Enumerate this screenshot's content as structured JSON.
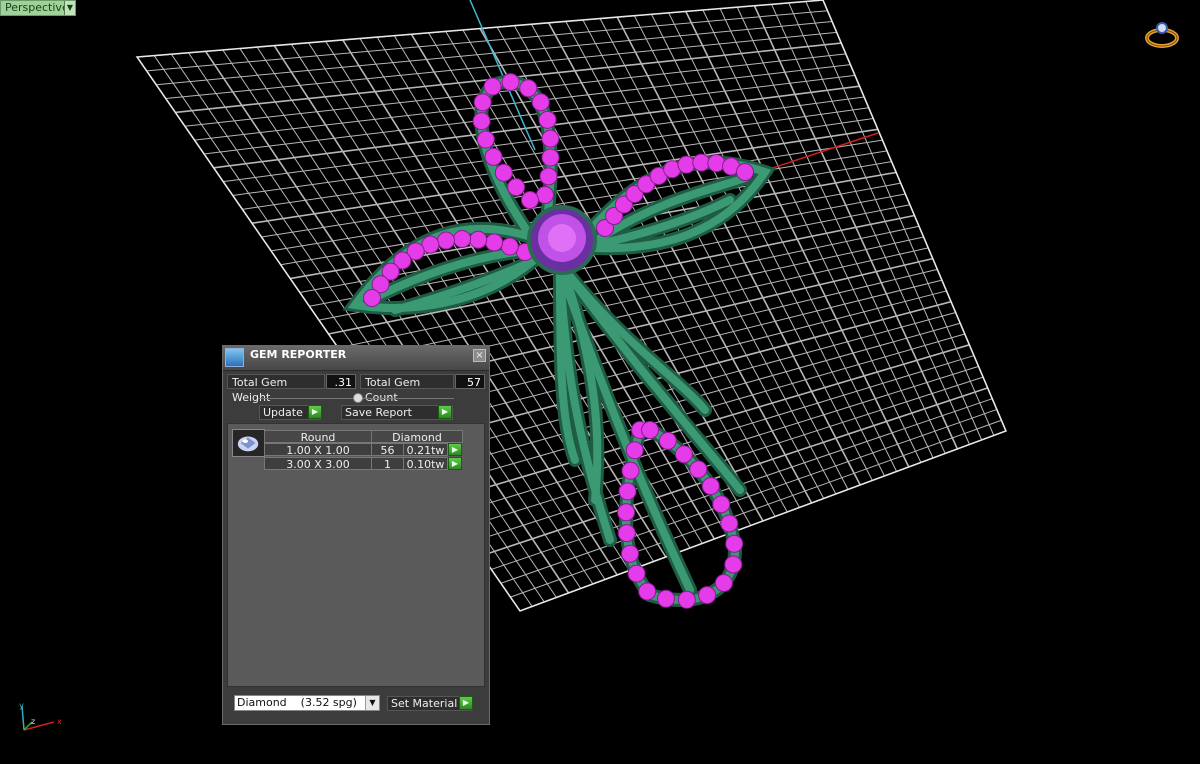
{
  "viewport": {
    "view_name": "Perspective",
    "axis_labels": {
      "y": "y",
      "z": "z",
      "x": "x"
    }
  },
  "gem_reporter": {
    "title": "GEM REPORTER",
    "close_glyph": "×",
    "total_gem_weight_label": "Total Gem Weight",
    "total_gem_weight_value": ".31",
    "total_gem_count_label": "Total Gem Count",
    "total_gem_count_value": "57",
    "update_label": "Update",
    "save_report_label": "Save Report",
    "table": {
      "headers": [
        "Round",
        "Diamond"
      ],
      "rows": [
        {
          "size": "1.00 X 1.00",
          "count": "56",
          "weight": "0.21tw"
        },
        {
          "size": "3.00 X 3.00",
          "count": "1",
          "weight": "0.10tw"
        }
      ]
    },
    "material_select": "Diamond    (3.52 spg)",
    "set_material_label": "Set Material"
  },
  "colors": {
    "background": "#000000",
    "grid": "#d8d8d8",
    "metal": "#2f7a5c",
    "gems": "#e43ce8",
    "center_stone": "#b04de0",
    "accent_green": "#3aa82e"
  }
}
